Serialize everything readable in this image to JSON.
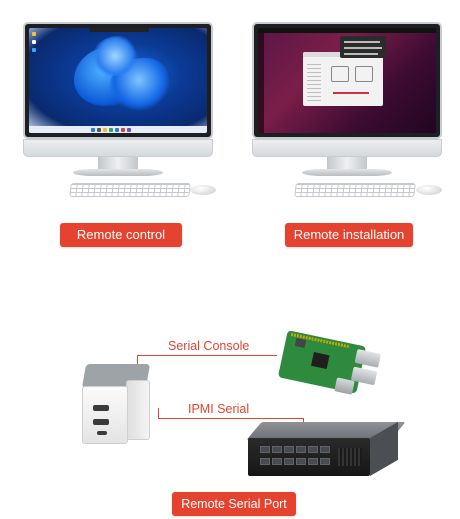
{
  "remote_control": {
    "label": "Remote control"
  },
  "remote_installation": {
    "label": "Remote installation"
  },
  "serial": {
    "console_label": "Serial Console",
    "ipmi_label": "IPMI Serial",
    "port_label": "Remote Serial Port"
  },
  "colors": {
    "accent": "#e5432f",
    "label_text": "#e5432f"
  },
  "icons": {
    "device": "kvm-device-icon",
    "raspberry_pi": "raspberry-pi-icon",
    "server": "rack-server-icon"
  }
}
